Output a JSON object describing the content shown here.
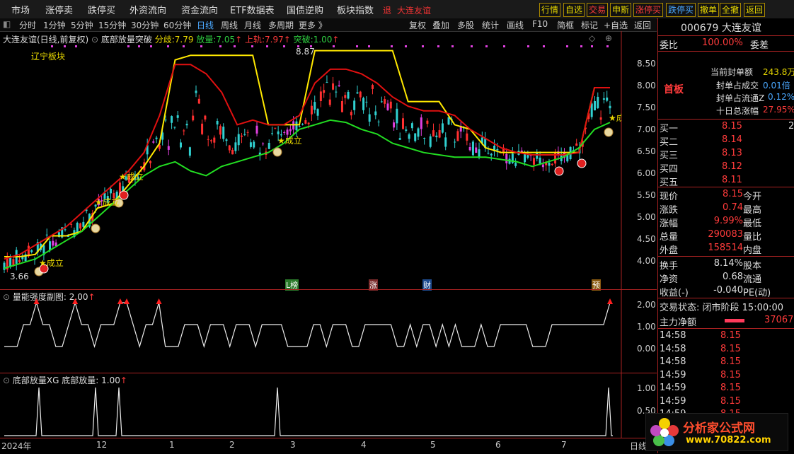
{
  "menubar": {
    "items": [
      "市场",
      "涨停卖",
      "跌停买",
      "外资流向",
      "资金流向",
      "ETF数据表",
      "国债逆购",
      "板块指数"
    ],
    "stock_tag": "退",
    "stock_name": "大连友谊",
    "buttons": [
      "行情",
      "自选",
      "交易",
      "申斯",
      "涨停买",
      "跌停买",
      "撤单",
      "全撤",
      "返回"
    ]
  },
  "toolbar": {
    "periods": [
      "分时",
      "1分钟",
      "5分钟",
      "15分钟",
      "30分钟",
      "60分钟",
      "日线",
      "周线",
      "月线",
      "多周期",
      "更多 》"
    ],
    "active_period": "日线",
    "tools": [
      "复权",
      "叠加",
      "多股",
      "统计",
      "画线",
      "F10",
      "简框",
      "标记",
      "+自选",
      "返回"
    ]
  },
  "main_chart": {
    "title": "大连友谊(日线,前复权)",
    "indicator": "底部放量突破",
    "fen_qi_label": "分歧:",
    "fen_qi_value": "7.79",
    "fang_liang_label": "放量:",
    "fang_liang_value": "7.05",
    "shang_gui_label": "上轨:",
    "shang_gui_value": "7.97",
    "tu_po_label": "突破:",
    "tu_po_value": "1.00",
    "sector_label": "辽宁板块",
    "high_mark": "8.87",
    "low_mark": "3.66",
    "y_ticks": [
      "8.50",
      "8.00",
      "7.50",
      "7.00",
      "6.50",
      "6.00",
      "5.50",
      "5.00",
      "4.50",
      "4.00"
    ],
    "events": [
      "L榜",
      "涨",
      "财",
      "预"
    ],
    "chengli": "★成立"
  },
  "sub1": {
    "title": "量能强度副图",
    "value": "2.00",
    "y_ticks": [
      "2.00",
      "1.00",
      "0.00"
    ]
  },
  "sub2": {
    "title": "底部放量XG",
    "label": "底部放量:",
    "value": "1.00",
    "y_ticks": [
      "1.00",
      "0.50"
    ]
  },
  "x_axis": {
    "labels": [
      "2024年",
      "12",
      "1",
      "2",
      "3",
      "4",
      "5",
      "6",
      "7"
    ],
    "period": "日线"
  },
  "quote": {
    "code": "000679",
    "name": "大连友谊",
    "wei_bi_label": "委比",
    "wei_bi": "100.00%",
    "wei_cha_label": "委差",
    "board_label": "首板",
    "seal_amount_label": "当前封单额",
    "seal_amount": "243.8万",
    "seal_deal_label": "封单占成交",
    "seal_deal": "0.01倍",
    "seal_float_label": "封单占流通Z",
    "seal_float": "0.12%",
    "ten_day_label": "十日总涨幅",
    "ten_day": "27.95%",
    "bids": [
      {
        "label": "买一",
        "price": "8.15",
        "vol": "2"
      },
      {
        "label": "买二",
        "price": "8.14",
        "vol": ""
      },
      {
        "label": "买三",
        "price": "8.13",
        "vol": ""
      },
      {
        "label": "买四",
        "price": "8.12",
        "vol": ""
      },
      {
        "label": "买五",
        "price": "8.11",
        "vol": ""
      }
    ],
    "stats": [
      {
        "l1": "现价",
        "v1": "8.15",
        "l2": "今开"
      },
      {
        "l1": "涨跌",
        "v1": "0.74",
        "l2": "最高"
      },
      {
        "l1": "涨幅",
        "v1": "9.99%",
        "l2": "最低"
      },
      {
        "l1": "总量",
        "v1": "290083",
        "l2": "量比"
      },
      {
        "l1": "外盘",
        "v1": "158514",
        "l2": "内盘"
      }
    ],
    "stats2": [
      {
        "l1": "换手",
        "v1": "8.14%",
        "l2": "股本"
      },
      {
        "l1": "净资",
        "v1": "0.68",
        "l2": "流通"
      },
      {
        "l1": "收益(-)",
        "v1": "-0.040",
        "l2": "PE(动)"
      }
    ],
    "trade_status_label": "交易状态:",
    "trade_status": "闭市阶段 15:00:00",
    "main_net_label": "主力净额",
    "main_net": "37067",
    "ticks": [
      {
        "t": "14:58",
        "p": "8.15"
      },
      {
        "t": "14:58",
        "p": "8.15"
      },
      {
        "t": "14:58",
        "p": "8.15"
      },
      {
        "t": "14:59",
        "p": "8.15"
      },
      {
        "t": "14:59",
        "p": "8.15"
      },
      {
        "t": "14:59",
        "p": "8.15"
      },
      {
        "t": "14:59",
        "p": "8.15"
      }
    ]
  },
  "watermark": {
    "brand": "分析家公式网",
    "url": "www.70822.com"
  },
  "chart_data": {
    "type": "line",
    "series": [
      {
        "name": "上轨",
        "values": [
          4.15,
          4.15,
          4.2,
          4.6,
          4.6,
          4.7,
          5.2,
          5.3,
          5.7,
          6.1,
          6.6,
          8.4,
          8.5,
          8.5,
          8.5,
          8.5,
          8.5,
          7.0,
          7.0,
          7.0,
          8.6,
          8.6,
          8.6,
          8.6,
          8.6,
          8.6,
          7.5,
          7.5,
          7.5,
          7.0,
          6.9,
          6.5,
          6.4,
          6.4,
          6.4,
          6.4,
          6.4,
          6.4,
          7.8,
          7.8
        ]
      },
      {
        "name": "分歧",
        "values": [
          4.1,
          4.2,
          4.4,
          4.6,
          4.8,
          5.1,
          5.4,
          5.7,
          6.0,
          6.4,
          7.2,
          8.3,
          8.3,
          8.1,
          7.7,
          7.0,
          7.1,
          7.0,
          7.0,
          7.2,
          7.9,
          8.2,
          8.2,
          8.1,
          7.9,
          7.6,
          7.4,
          7.3,
          7.3,
          7.2,
          6.9,
          6.7,
          6.5,
          6.4,
          6.35,
          6.35,
          6.35,
          6.4,
          7.8,
          7.8
        ]
      },
      {
        "name": "放量",
        "values": [
          3.9,
          4.0,
          4.1,
          4.3,
          4.5,
          4.7,
          5.0,
          5.3,
          5.6,
          5.9,
          6.1,
          6.2,
          6.0,
          5.9,
          6.1,
          6.2,
          6.3,
          6.4,
          6.6,
          6.9,
          7.0,
          7.1,
          7.05,
          6.9,
          6.8,
          6.6,
          6.5,
          6.4,
          6.35,
          6.3,
          6.3,
          6.3,
          6.25,
          6.2,
          6.1,
          6.2,
          6.3,
          6.5,
          6.9,
          7.05
        ]
      }
    ],
    "ylim": [
      3.6,
      8.9
    ]
  }
}
